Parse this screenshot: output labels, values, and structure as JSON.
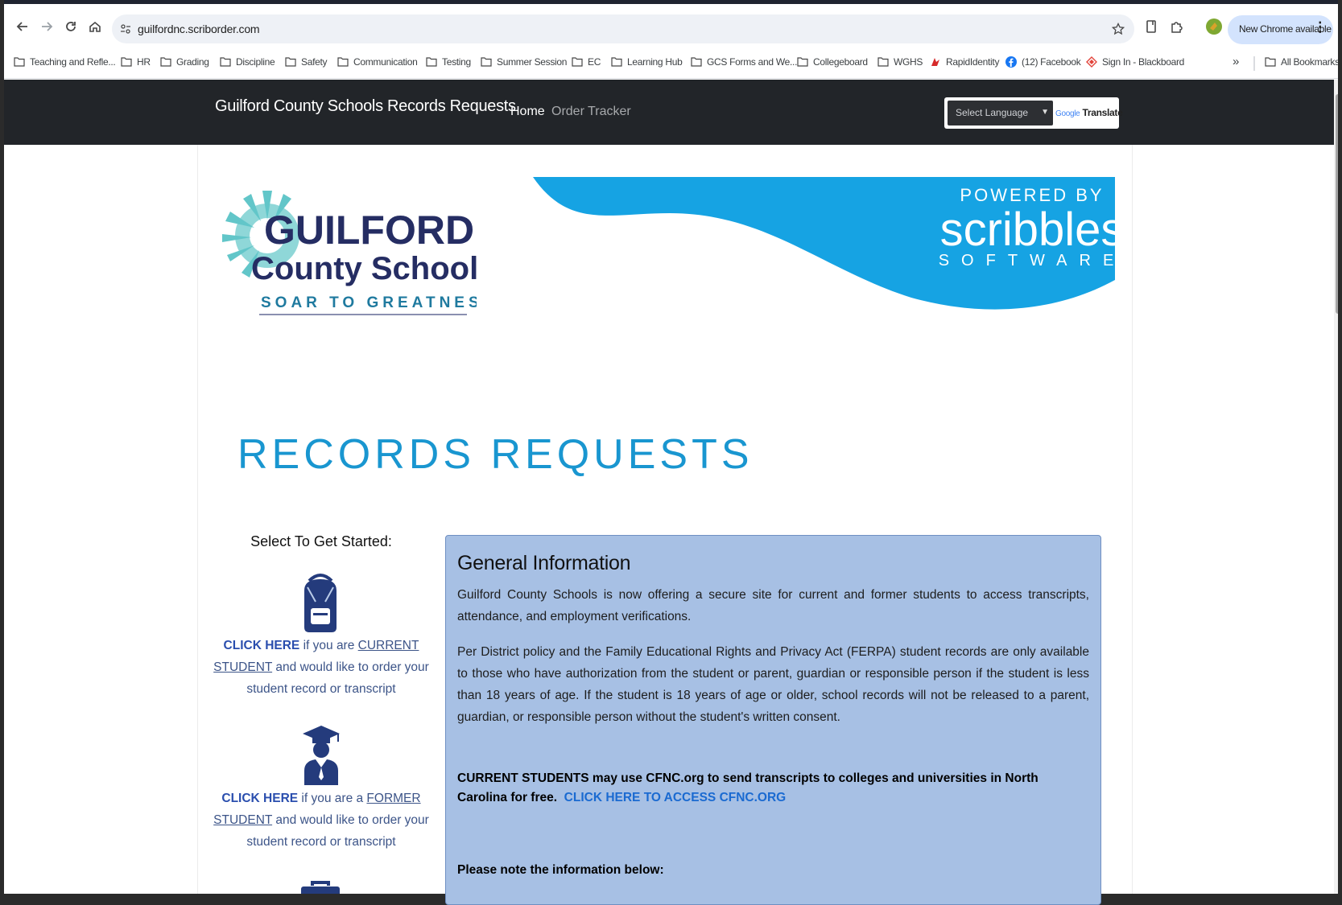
{
  "browser": {
    "url": "guilfordnc.scriborder.com",
    "new_chrome": "New Chrome available",
    "bookmarks": [
      {
        "label": "Teaching and Refle...",
        "icon": "folder-icon"
      },
      {
        "label": "HR",
        "icon": "folder-icon"
      },
      {
        "label": "Grading",
        "icon": "folder-icon"
      },
      {
        "label": "Discipline",
        "icon": "folder-icon"
      },
      {
        "label": "Safety",
        "icon": "folder-icon"
      },
      {
        "label": "Communication",
        "icon": "folder-icon"
      },
      {
        "label": "Testing",
        "icon": "folder-icon"
      },
      {
        "label": "Summer Session",
        "icon": "folder-icon"
      },
      {
        "label": "EC",
        "icon": "folder-icon"
      },
      {
        "label": "Learning Hub",
        "icon": "folder-icon"
      },
      {
        "label": "GCS Forms and We...",
        "icon": "folder-icon"
      },
      {
        "label": "Collegeboard",
        "icon": "folder-icon"
      },
      {
        "label": "WGHS",
        "icon": "folder-icon"
      },
      {
        "label": "RapidIdentity",
        "icon": "rapididentity-icon"
      },
      {
        "label": "(12) Facebook",
        "icon": "facebook-icon"
      },
      {
        "label": "Sign In - Blackboard",
        "icon": "blackboard-icon"
      }
    ],
    "overflow": "»",
    "all_bookmarks": "All Bookmarks"
  },
  "site": {
    "brand": "Guilford County Schools Records Requests",
    "nav": {
      "home": "Home",
      "order_tracker": "Order Tracker"
    },
    "translate": {
      "select_label": "Select Language",
      "google": "Google",
      "translate": "Translate"
    }
  },
  "logo": {
    "line1": "GUILFORD",
    "line2": "County Schools",
    "tagline": "SOAR TO GREATNESS"
  },
  "powered": {
    "line1": "POWERED BY",
    "line2": "scribbles",
    "line3": "SOFTWARE"
  },
  "page_title": "RECORDS REQUESTS",
  "sidebar": {
    "heading": "Select To Get Started:",
    "current": {
      "cta": "CLICK HERE",
      "pre": " if you are ",
      "link": "CURRENT STUDENT",
      "post": " and would like to order your student record or transcript"
    },
    "former": {
      "cta": "CLICK HERE",
      "pre": " if you are a ",
      "link": "FORMER STUDENT",
      "post": " and would like to order your student record or transcript"
    }
  },
  "general_info": {
    "title": "General Information",
    "p1": "Guilford County Schools is now offering a secure site for current and former students to access transcripts, attendance, and employment verifications.",
    "p2": "Per District policy and the Family Educational Rights and Privacy Act (FERPA) student records are only available to those who have authorization from the student or parent, guardian or responsible person if the student is less than 18 years of age. If the student is 18 years of age or older, school records will not be released to a parent, guardian, or responsible person without the student's written consent.",
    "cfnc_text": "CURRENT STUDENTS may use CFNC.org to send transcripts to colleges and universities in North Carolina for free.",
    "cfnc_link": "CLICK HERE TO ACCESS CFNC.ORG",
    "note": "Please note the information below:"
  },
  "colors": {
    "nav_bg": "#222529",
    "accent": "#1996d0",
    "info_bg": "#a7c0e4",
    "link": "#2a4eae"
  }
}
